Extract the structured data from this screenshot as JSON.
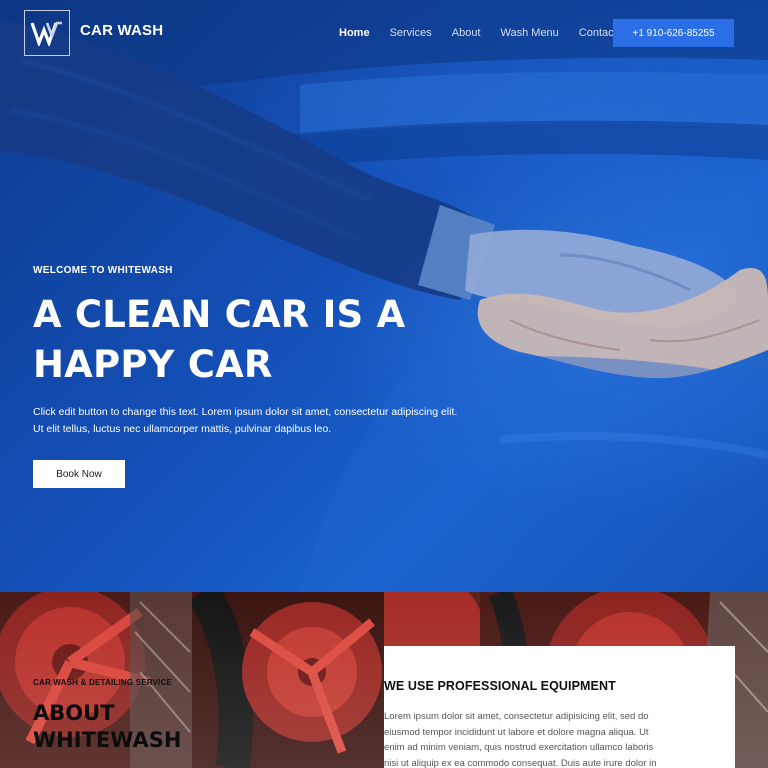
{
  "header": {
    "brand": "CAR WASH",
    "nav": [
      "Home",
      "Services",
      "About",
      "Wash Menu",
      "Contact"
    ],
    "active_nav": "Home",
    "phone_label": "+1 910-626-85255"
  },
  "hero": {
    "eyebrow": "WELCOME TO WHITEWASH",
    "headline_line1": "A CLEAN CAR IS A",
    "headline_line2": "HAPPY CAR",
    "text": "Click edit button to change this text. Lorem ipsum dolor sit amet, consectetur adipiscing elit. Ut elit tellus, luctus nec ullamcorper mattis, pulvinar dapibus leo.",
    "cta_label": "Book Now"
  },
  "about": {
    "eyebrow": "CAR WASH & DETAILING SERVICE",
    "title": "ABOUT WHITEWASH"
  },
  "card": {
    "title": "WE USE PROFESSIONAL EQUIPMENT",
    "text": "Lorem ipsum dolor sit amet, consectetur adipisicing elit, sed do eiusmod tempor incididunt ut labore et dolore magna aliqua. Ut enim ad minim veniam, quis nostrud exercitation ullamco laboris nisi ut aliquip ex ea commodo consequat. Duis aute irure dolor in"
  },
  "colors": {
    "hero_overlay": "#1450b8",
    "accent_button": "#2c6ee6",
    "white": "#ffffff"
  },
  "icons": {
    "logo": "w-monogram-icon"
  }
}
